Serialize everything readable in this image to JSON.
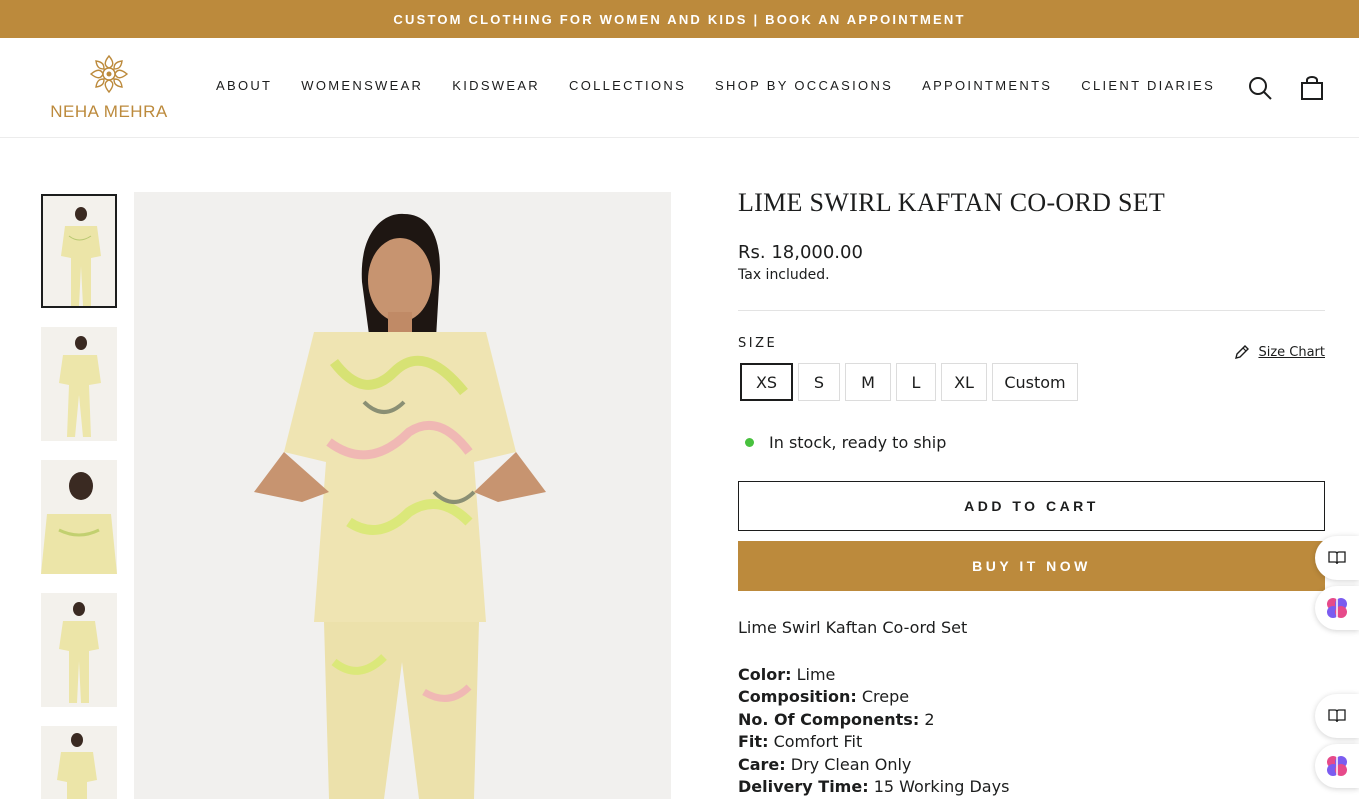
{
  "announcement": "CUSTOM CLOTHING FOR WOMEN AND KIDS | BOOK AN APPOINTMENT",
  "brand": {
    "name": "NEHA MEHRA",
    "color": "#bc8a3c"
  },
  "nav": [
    "ABOUT",
    "WOMENSWEAR",
    "KIDSWEAR",
    "COLLECTIONS",
    "SHOP BY OCCASIONS",
    "APPOINTMENTS",
    "CLIENT DIARIES"
  ],
  "header_icons": {
    "search": "search-icon",
    "cart": "cart-bag-icon"
  },
  "product": {
    "title": "LIME SWIRL KAFTAN CO-ORD SET",
    "price": "Rs. 18,000.00",
    "tax_note": "Tax included.",
    "size_label": "SIZE",
    "size_chart_label": "Size Chart",
    "sizes": [
      "XS",
      "S",
      "M",
      "L",
      "XL",
      "Custom"
    ],
    "selected_size": "XS",
    "stock_status": "In stock, ready to ship",
    "add_to_cart": "ADD TO CART",
    "buy_now": "BUY IT NOW",
    "description": "Lime Swirl Kaftan Co-ord Set",
    "specs": [
      {
        "label": "Color:",
        "value": "Lime"
      },
      {
        "label": "Composition:",
        "value": "Crepe"
      },
      {
        "label": "No. Of Components:",
        "value": "2"
      },
      {
        "label": "Fit:",
        "value": "Comfort Fit"
      },
      {
        "label": "Care:",
        "value": "Dry Clean Only"
      },
      {
        "label": "Delivery Time:",
        "value": "15 Working Days"
      }
    ]
  },
  "colors": {
    "accent": "#bc8a3c",
    "stock_dot": "#48c13e",
    "text": "#1c1d1d"
  },
  "floating_icons": [
    "book-icon",
    "brain-icon",
    "book-icon",
    "brain-icon"
  ]
}
